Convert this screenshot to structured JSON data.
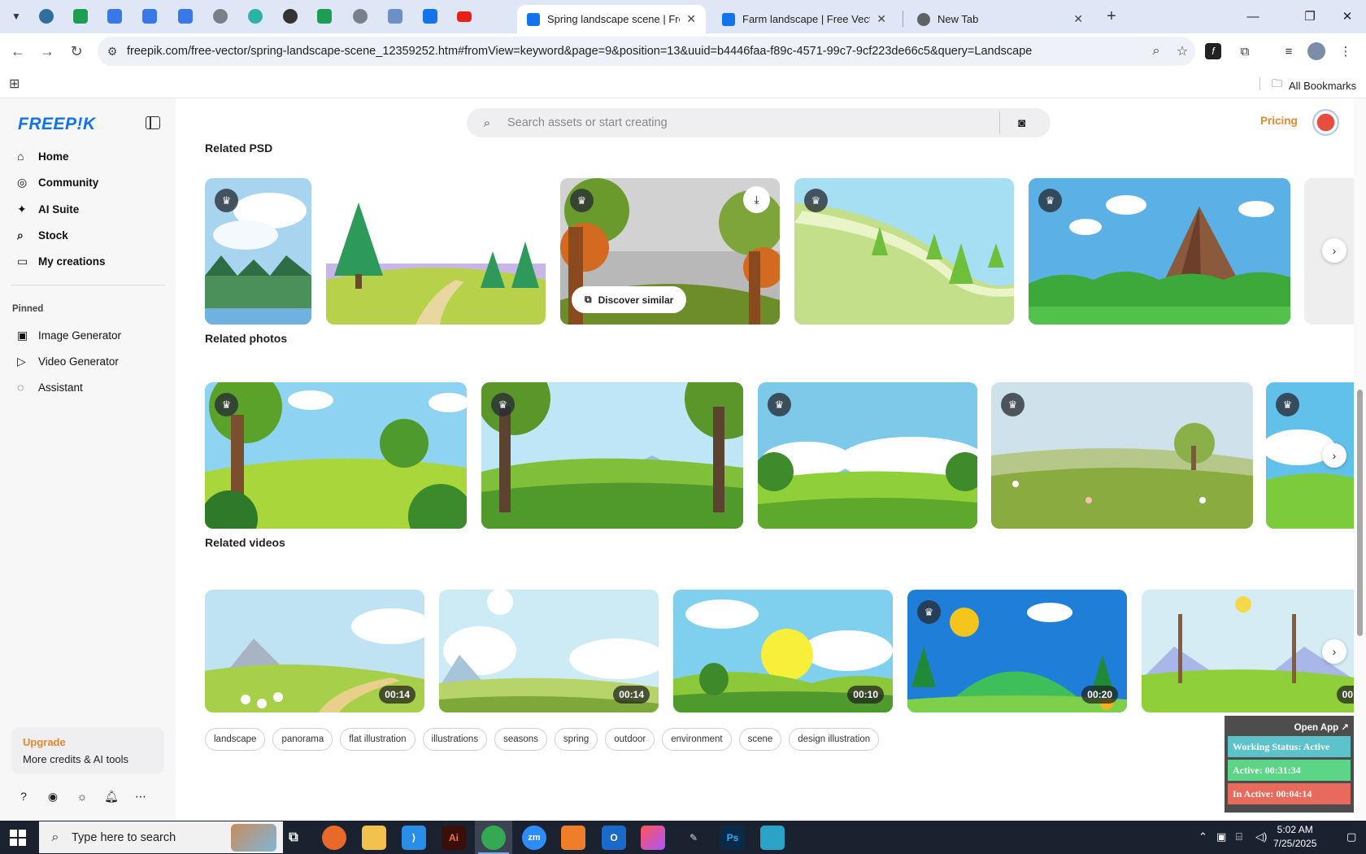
{
  "browser": {
    "tabs": [
      {
        "title": "Spring landscape scene | Free V",
        "active": true,
        "favicon_color": "#1273eb"
      },
      {
        "title": "Farm landscape | Free Vector",
        "active": false,
        "favicon_color": "#1273eb"
      },
      {
        "title": "New Tab",
        "active": false,
        "favicon_color": "#5f6368"
      }
    ],
    "url": "freepik.com/free-vector/spring-landscape-scene_12359252.htm#fromView=keyword&page=9&position=13&uuid=b4446faa-f89c-4571-99c7-9cf223de66c5&query=Landscape",
    "bookmarks_label": "All Bookmarks"
  },
  "sidebar": {
    "logo": "FREEP!K",
    "nav": [
      {
        "label": "Home",
        "icon": "home-icon"
      },
      {
        "label": "Community",
        "icon": "globe-icon"
      },
      {
        "label": "AI Suite",
        "icon": "sparkle-icon"
      },
      {
        "label": "Stock",
        "icon": "search-icon"
      },
      {
        "label": "My creations",
        "icon": "folder-icon"
      }
    ],
    "pinned_label": "Pinned",
    "pinned": [
      {
        "label": "Image Generator",
        "icon": "image-icon"
      },
      {
        "label": "Video Generator",
        "icon": "video-icon"
      },
      {
        "label": "Assistant",
        "icon": "chat-icon"
      }
    ],
    "upgrade_title": "Upgrade",
    "upgrade_subtitle": "More credits & AI tools"
  },
  "header": {
    "search_placeholder": "Search assets or start creating",
    "pricing": "Pricing"
  },
  "sections": {
    "psd_title": "Related PSD",
    "photos_title": "Related photos",
    "videos_title": "Related videos",
    "discover_label": "Discover similar"
  },
  "videos": [
    {
      "duration": "00:14"
    },
    {
      "duration": "00:14"
    },
    {
      "duration": "00:10"
    },
    {
      "duration": "00:20"
    },
    {
      "duration": "00:"
    }
  ],
  "tags": [
    "landscape",
    "panorama",
    "flat illustration",
    "illustrations",
    "seasons",
    "spring",
    "outdoor",
    "environment",
    "scene",
    "design illustration"
  ],
  "tracker": {
    "open_app": "Open App ↗",
    "working_status": "Working Status: Active",
    "active": "Active: 00:31:34",
    "inactive": "In Active: 00:04:14",
    "colors": {
      "status": "#5bc3c9",
      "active": "#5cd686",
      "inactive": "#e86a5c"
    }
  },
  "taskbar": {
    "search_placeholder": "Type here to search",
    "time": "5:02 AM",
    "date": "7/25/2025"
  }
}
